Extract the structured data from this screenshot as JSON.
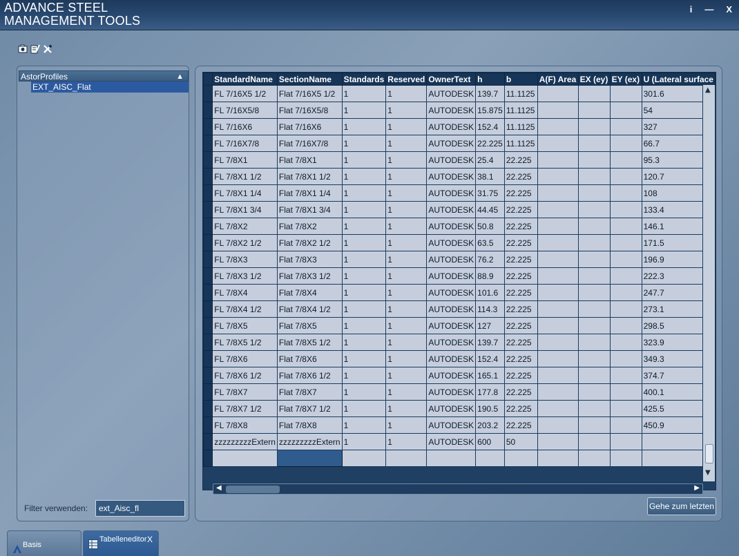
{
  "app": {
    "title_line1": "ADVANCE STEEL",
    "title_line2": "MANAGEMENT TOOLS"
  },
  "window_controls": {
    "info": "i",
    "minimize": "—",
    "close": "X"
  },
  "toolbar": {
    "icons": [
      "camera-icon",
      "edit-doc-icon",
      "tools-icon"
    ]
  },
  "tree": {
    "root": "AstorProfiles",
    "items": [
      "EXT_AISC_Flat"
    ]
  },
  "filter": {
    "label": "Filter verwenden:",
    "value": "ext_Aisc_fl"
  },
  "grid": {
    "columns": [
      "StandardName",
      "SectionName",
      "Standards",
      "Reserved",
      "OwnerText",
      "h",
      "b",
      "A(F) Area",
      "EX (ey)",
      "EY (ex)",
      "U (Lateral surface"
    ],
    "rows": [
      [
        "FL 7/16X5 1/2",
        "Flat 7/16X5 1/2",
        "1",
        "1",
        "AUTODESK",
        "139.7",
        "11.1125",
        "",
        "",
        "",
        "301.6"
      ],
      [
        "FL 7/16X5/8",
        "Flat 7/16X5/8",
        "1",
        "1",
        "AUTODESK",
        "15.875",
        "11.1125",
        "",
        "",
        "",
        "54"
      ],
      [
        "FL 7/16X6",
        "Flat 7/16X6",
        "1",
        "1",
        "AUTODESK",
        "152.4",
        "11.1125",
        "",
        "",
        "",
        "327"
      ],
      [
        "FL 7/16X7/8",
        "Flat 7/16X7/8",
        "1",
        "1",
        "AUTODESK",
        "22.225",
        "11.1125",
        "",
        "",
        "",
        "66.7"
      ],
      [
        "FL 7/8X1",
        "Flat 7/8X1",
        "1",
        "1",
        "AUTODESK",
        "25.4",
        "22.225",
        "",
        "",
        "",
        "95.3"
      ],
      [
        "FL 7/8X1 1/2",
        "Flat 7/8X1 1/2",
        "1",
        "1",
        "AUTODESK",
        "38.1",
        "22.225",
        "",
        "",
        "",
        "120.7"
      ],
      [
        "FL 7/8X1 1/4",
        "Flat 7/8X1 1/4",
        "1",
        "1",
        "AUTODESK",
        "31.75",
        "22.225",
        "",
        "",
        "",
        "108"
      ],
      [
        "FL 7/8X1 3/4",
        "Flat 7/8X1 3/4",
        "1",
        "1",
        "AUTODESK",
        "44.45",
        "22.225",
        "",
        "",
        "",
        "133.4"
      ],
      [
        "FL 7/8X2",
        "Flat 7/8X2",
        "1",
        "1",
        "AUTODESK",
        "50.8",
        "22.225",
        "",
        "",
        "",
        "146.1"
      ],
      [
        "FL 7/8X2 1/2",
        "Flat 7/8X2 1/2",
        "1",
        "1",
        "AUTODESK",
        "63.5",
        "22.225",
        "",
        "",
        "",
        "171.5"
      ],
      [
        "FL 7/8X3",
        "Flat 7/8X3",
        "1",
        "1",
        "AUTODESK",
        "76.2",
        "22.225",
        "",
        "",
        "",
        "196.9"
      ],
      [
        "FL 7/8X3 1/2",
        "Flat 7/8X3 1/2",
        "1",
        "1",
        "AUTODESK",
        "88.9",
        "22.225",
        "",
        "",
        "",
        "222.3"
      ],
      [
        "FL 7/8X4",
        "Flat 7/8X4",
        "1",
        "1",
        "AUTODESK",
        "101.6",
        "22.225",
        "",
        "",
        "",
        "247.7"
      ],
      [
        "FL 7/8X4 1/2",
        "Flat 7/8X4 1/2",
        "1",
        "1",
        "AUTODESK",
        "114.3",
        "22.225",
        "",
        "",
        "",
        "273.1"
      ],
      [
        "FL 7/8X5",
        "Flat 7/8X5",
        "1",
        "1",
        "AUTODESK",
        "127",
        "22.225",
        "",
        "",
        "",
        "298.5"
      ],
      [
        "FL 7/8X5 1/2",
        "Flat 7/8X5 1/2",
        "1",
        "1",
        "AUTODESK",
        "139.7",
        "22.225",
        "",
        "",
        "",
        "323.9"
      ],
      [
        "FL 7/8X6",
        "Flat 7/8X6",
        "1",
        "1",
        "AUTODESK",
        "152.4",
        "22.225",
        "",
        "",
        "",
        "349.3"
      ],
      [
        "FL 7/8X6 1/2",
        "Flat 7/8X6 1/2",
        "1",
        "1",
        "AUTODESK",
        "165.1",
        "22.225",
        "",
        "",
        "",
        "374.7"
      ],
      [
        "FL 7/8X7",
        "Flat 7/8X7",
        "1",
        "1",
        "AUTODESK",
        "177.8",
        "22.225",
        "",
        "",
        "",
        "400.1"
      ],
      [
        "FL 7/8X7 1/2",
        "Flat 7/8X7 1/2",
        "1",
        "1",
        "AUTODESK",
        "190.5",
        "22.225",
        "",
        "",
        "",
        "425.5"
      ],
      [
        "FL 7/8X8",
        "Flat 7/8X8",
        "1",
        "1",
        "AUTODESK",
        "203.2",
        "22.225",
        "",
        "",
        "",
        "450.9"
      ],
      [
        "zzzzzzzzzExtern",
        "zzzzzzzzzExtern",
        "1",
        "1",
        "AUTODESK",
        "600",
        "50",
        "",
        "",
        "",
        ""
      ],
      [
        "",
        "",
        "",
        "",
        "",
        "",
        "",
        "",
        "",
        "",
        ""
      ]
    ]
  },
  "goto_last_button": "Gehe zum letzten",
  "tabs": [
    {
      "label": "Basis",
      "icon": "autodesk-logo-icon"
    },
    {
      "label": "Tabelleneditor",
      "icon": "table-icon",
      "close": "X"
    }
  ],
  "colors": {
    "titlebar": "#1e3a5c",
    "selection": "#2c5aa0",
    "grid_header": "#173558",
    "cell": "#c6cedd"
  }
}
